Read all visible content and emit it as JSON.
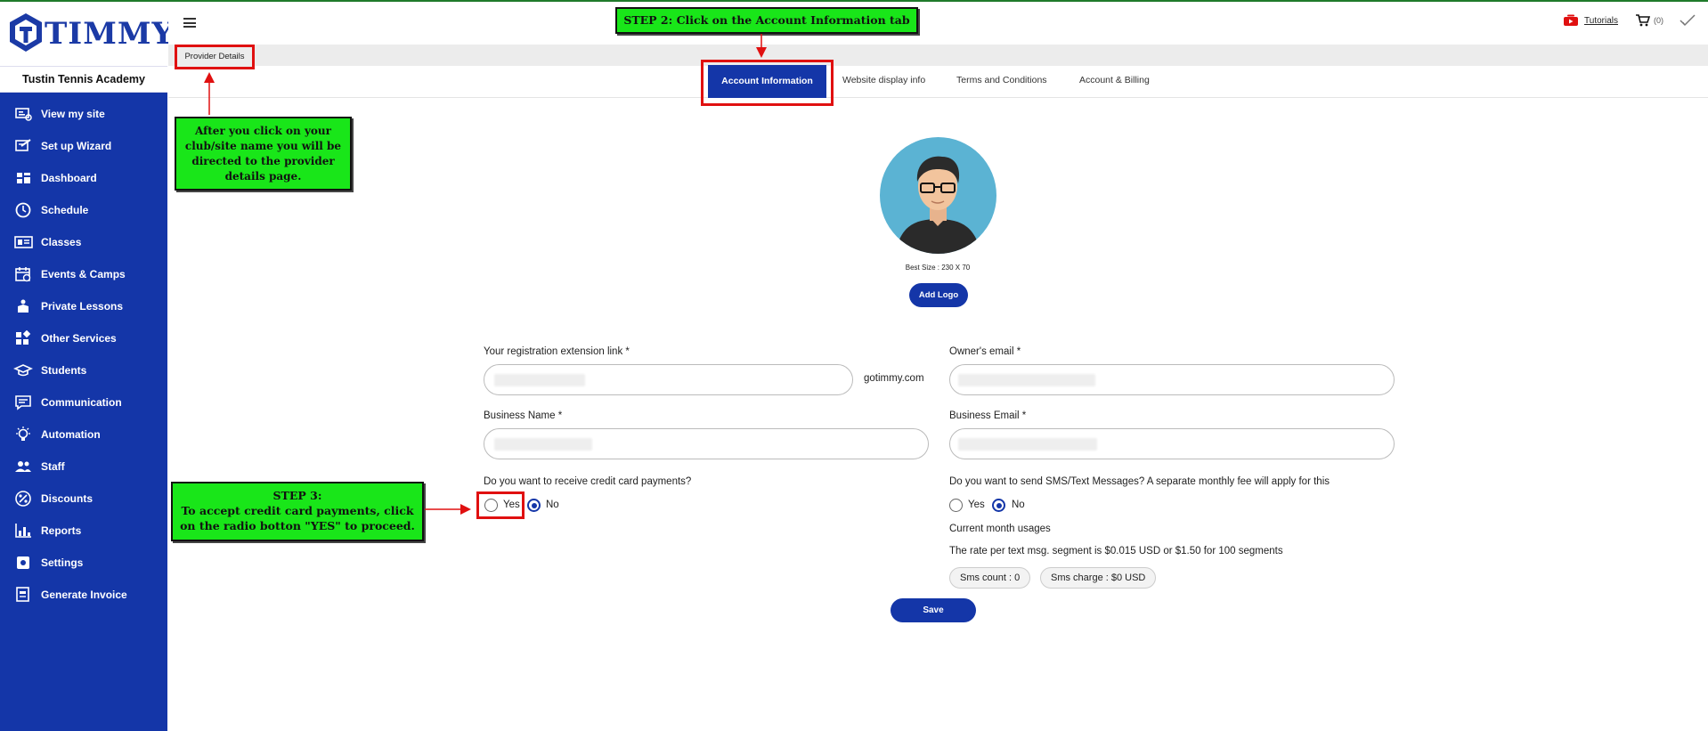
{
  "brand": {
    "logo_text": "TIMMY",
    "site_name": "Tustin Tennis Academy"
  },
  "sidebar": {
    "items": [
      {
        "label": "View my site",
        "icon": "view-site-icon"
      },
      {
        "label": "Set up Wizard",
        "icon": "wizard-icon"
      },
      {
        "label": "Dashboard",
        "icon": "dashboard-icon"
      },
      {
        "label": "Schedule",
        "icon": "clock-icon"
      },
      {
        "label": "Classes",
        "icon": "classes-icon"
      },
      {
        "label": "Events & Camps",
        "icon": "calendar-icon"
      },
      {
        "label": "Private Lessons",
        "icon": "private-lessons-icon"
      },
      {
        "label": "Other Services",
        "icon": "services-icon"
      },
      {
        "label": "Students",
        "icon": "graduation-cap-icon"
      },
      {
        "label": "Communication",
        "icon": "chat-icon"
      },
      {
        "label": "Automation",
        "icon": "lightbulb-icon"
      },
      {
        "label": "Staff",
        "icon": "staff-icon"
      },
      {
        "label": "Discounts",
        "icon": "percent-icon"
      },
      {
        "label": "Reports",
        "icon": "chart-icon"
      },
      {
        "label": "Settings",
        "icon": "gear-icon"
      },
      {
        "label": "Generate Invoice",
        "icon": "invoice-icon"
      }
    ]
  },
  "header": {
    "tutorials": "Tutorials",
    "cart_count": "(0)"
  },
  "provider_details": "Provider Details",
  "tabs": [
    {
      "label": "Account Information",
      "active": true
    },
    {
      "label": "Website display info"
    },
    {
      "label": "Terms and Conditions"
    },
    {
      "label": "Account & Billing"
    }
  ],
  "callouts": {
    "step2": "STEP 2: Click on the Account Information tab",
    "provider_note": "After you click on your club/site name you will be directed to the provider details page.",
    "step3_title": "STEP 3:",
    "step3_body": "To  accept credit card payments, click on the radio botton  \"YES\" to proceed."
  },
  "logo_section": {
    "best_size": "Best Size : 230 X 70",
    "add_logo": "Add Logo"
  },
  "form": {
    "registration_link_label": "Your registration extension link *",
    "domain_suffix": "gotimmy.com",
    "owner_email_label": "Owner's email *",
    "business_name_label": "Business Name *",
    "business_email_label": "Business Email *",
    "cc_question": "Do you want to receive credit card payments?",
    "cc_yes": "Yes",
    "cc_no": "No",
    "cc_selected": "No",
    "sms_question": "Do you want to send SMS/Text Messages? A separate monthly fee will apply for this",
    "sms_yes": "Yes",
    "sms_no": "No",
    "sms_selected": "No",
    "current_usage": "Current month usages",
    "rate_text": "The rate per text msg. segment is $0.015 USD or $1.50 for 100 segments",
    "sms_count": "Sms count : 0",
    "sms_charge": "Sms charge : $0 USD",
    "save": "Save"
  },
  "colors": {
    "brand_blue": "#1436a8",
    "callout_green": "#19e619",
    "highlight_red": "#e01010"
  }
}
